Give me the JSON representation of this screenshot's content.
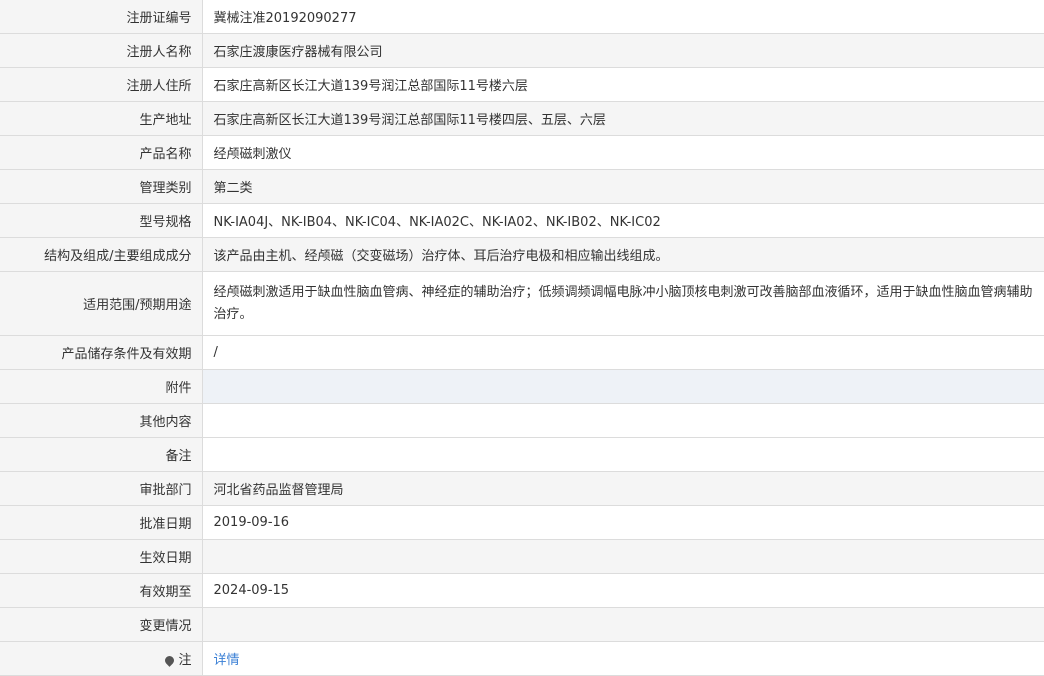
{
  "rows": [
    {
      "label": "注册证编号",
      "value": "冀械注准20192090277"
    },
    {
      "label": "注册人名称",
      "value": "石家庄渡康医疗器械有限公司"
    },
    {
      "label": "注册人住所",
      "value": "石家庄高新区长江大道139号润江总部国际11号楼六层"
    },
    {
      "label": "生产地址",
      "value": "石家庄高新区长江大道139号润江总部国际11号楼四层、五层、六层"
    },
    {
      "label": "产品名称",
      "value": "经颅磁刺激仪"
    },
    {
      "label": "管理类别",
      "value": "第二类"
    },
    {
      "label": "型号规格",
      "value": "NK-IA04J、NK-IB04、NK-IC04、NK-IA02C、NK-IA02、NK-IB02、NK-IC02"
    },
    {
      "label": "结构及组成/主要组成成分",
      "value": "该产品由主机、经颅磁（交变磁场）治疗体、耳后治疗电极和相应输出线组成。"
    },
    {
      "label": "适用范围/预期用途",
      "value": "经颅磁刺激适用于缺血性脑血管病、神经症的辅助治疗；低频调频调幅电脉冲小脑顶核电刺激可改善脑部血液循环，适用于缺血性脑血管病辅助治疗。"
    },
    {
      "label": "产品储存条件及有效期",
      "value": "/"
    },
    {
      "label": "附件",
      "value": ""
    },
    {
      "label": "其他内容",
      "value": ""
    },
    {
      "label": "备注",
      "value": ""
    },
    {
      "label": "审批部门",
      "value": "河北省药品监督管理局"
    },
    {
      "label": "批准日期",
      "value": "2019-09-16"
    },
    {
      "label": "生效日期",
      "value": ""
    },
    {
      "label": "有效期至",
      "value": "2024-09-15"
    },
    {
      "label": "变更情况",
      "value": ""
    }
  ],
  "note": {
    "label": "注",
    "link_text": "详情",
    "icon": "location-pin-icon"
  }
}
